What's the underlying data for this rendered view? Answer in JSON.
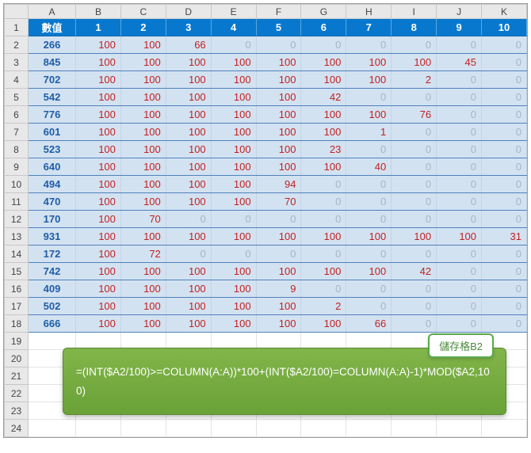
{
  "columns": [
    "A",
    "B",
    "C",
    "D",
    "E",
    "F",
    "G",
    "H",
    "I",
    "J",
    "K"
  ],
  "row_numbers": [
    1,
    2,
    3,
    4,
    5,
    6,
    7,
    8,
    9,
    10,
    11,
    12,
    13,
    14,
    15,
    16,
    17,
    18,
    19,
    20,
    21,
    22,
    23,
    24
  ],
  "header": {
    "label": "數值",
    "nums": [
      1,
      2,
      3,
      4,
      5,
      6,
      7,
      8,
      9,
      10
    ]
  },
  "rows": [
    {
      "val": 266,
      "cells": [
        100,
        100,
        66,
        0,
        0,
        0,
        0,
        0,
        0,
        0
      ]
    },
    {
      "val": 845,
      "cells": [
        100,
        100,
        100,
        100,
        100,
        100,
        100,
        100,
        45,
        0
      ]
    },
    {
      "val": 702,
      "cells": [
        100,
        100,
        100,
        100,
        100,
        100,
        100,
        2,
        0,
        0
      ]
    },
    {
      "val": 542,
      "cells": [
        100,
        100,
        100,
        100,
        100,
        42,
        0,
        0,
        0,
        0
      ]
    },
    {
      "val": 776,
      "cells": [
        100,
        100,
        100,
        100,
        100,
        100,
        100,
        76,
        0,
        0
      ]
    },
    {
      "val": 601,
      "cells": [
        100,
        100,
        100,
        100,
        100,
        100,
        1,
        0,
        0,
        0
      ]
    },
    {
      "val": 523,
      "cells": [
        100,
        100,
        100,
        100,
        100,
        23,
        0,
        0,
        0,
        0
      ]
    },
    {
      "val": 640,
      "cells": [
        100,
        100,
        100,
        100,
        100,
        100,
        40,
        0,
        0,
        0
      ]
    },
    {
      "val": 494,
      "cells": [
        100,
        100,
        100,
        100,
        94,
        0,
        0,
        0,
        0,
        0
      ]
    },
    {
      "val": 470,
      "cells": [
        100,
        100,
        100,
        100,
        70,
        0,
        0,
        0,
        0,
        0
      ]
    },
    {
      "val": 170,
      "cells": [
        100,
        70,
        0,
        0,
        0,
        0,
        0,
        0,
        0,
        0
      ]
    },
    {
      "val": 931,
      "cells": [
        100,
        100,
        100,
        100,
        100,
        100,
        100,
        100,
        100,
        31
      ]
    },
    {
      "val": 172,
      "cells": [
        100,
        72,
        0,
        0,
        0,
        0,
        0,
        0,
        0,
        0
      ]
    },
    {
      "val": 742,
      "cells": [
        100,
        100,
        100,
        100,
        100,
        100,
        100,
        42,
        0,
        0
      ]
    },
    {
      "val": 409,
      "cells": [
        100,
        100,
        100,
        100,
        9,
        0,
        0,
        0,
        0,
        0
      ]
    },
    {
      "val": 502,
      "cells": [
        100,
        100,
        100,
        100,
        100,
        2,
        0,
        0,
        0,
        0
      ]
    },
    {
      "val": 666,
      "cells": [
        100,
        100,
        100,
        100,
        100,
        100,
        66,
        0,
        0,
        0
      ]
    }
  ],
  "callout": {
    "tag": "儲存格B2",
    "formula": "=(INT($A2/100)>=COLUMN(A:A))*100+(INT($A2/100)=COLUMN(A:A)-1)*MOD($A2,100)"
  },
  "chart_data": {
    "type": "table",
    "title": "數值",
    "categories": [
      1,
      2,
      3,
      4,
      5,
      6,
      7,
      8,
      9,
      10
    ],
    "series": [
      {
        "name": 266,
        "values": [
          100,
          100,
          66,
          0,
          0,
          0,
          0,
          0,
          0,
          0
        ]
      },
      {
        "name": 845,
        "values": [
          100,
          100,
          100,
          100,
          100,
          100,
          100,
          100,
          45,
          0
        ]
      },
      {
        "name": 702,
        "values": [
          100,
          100,
          100,
          100,
          100,
          100,
          100,
          2,
          0,
          0
        ]
      },
      {
        "name": 542,
        "values": [
          100,
          100,
          100,
          100,
          100,
          42,
          0,
          0,
          0,
          0
        ]
      },
      {
        "name": 776,
        "values": [
          100,
          100,
          100,
          100,
          100,
          100,
          100,
          76,
          0,
          0
        ]
      },
      {
        "name": 601,
        "values": [
          100,
          100,
          100,
          100,
          100,
          100,
          1,
          0,
          0,
          0
        ]
      },
      {
        "name": 523,
        "values": [
          100,
          100,
          100,
          100,
          100,
          23,
          0,
          0,
          0,
          0
        ]
      },
      {
        "name": 640,
        "values": [
          100,
          100,
          100,
          100,
          100,
          100,
          40,
          0,
          0,
          0
        ]
      },
      {
        "name": 494,
        "values": [
          100,
          100,
          100,
          100,
          94,
          0,
          0,
          0,
          0,
          0
        ]
      },
      {
        "name": 470,
        "values": [
          100,
          100,
          100,
          100,
          70,
          0,
          0,
          0,
          0,
          0
        ]
      },
      {
        "name": 170,
        "values": [
          100,
          70,
          0,
          0,
          0,
          0,
          0,
          0,
          0,
          0
        ]
      },
      {
        "name": 931,
        "values": [
          100,
          100,
          100,
          100,
          100,
          100,
          100,
          100,
          100,
          31
        ]
      },
      {
        "name": 172,
        "values": [
          100,
          72,
          0,
          0,
          0,
          0,
          0,
          0,
          0,
          0
        ]
      },
      {
        "name": 742,
        "values": [
          100,
          100,
          100,
          100,
          100,
          100,
          100,
          42,
          0,
          0
        ]
      },
      {
        "name": 409,
        "values": [
          100,
          100,
          100,
          100,
          9,
          0,
          0,
          0,
          0,
          0
        ]
      },
      {
        "name": 502,
        "values": [
          100,
          100,
          100,
          100,
          100,
          2,
          0,
          0,
          0,
          0
        ]
      },
      {
        "name": 666,
        "values": [
          100,
          100,
          100,
          100,
          100,
          100,
          66,
          0,
          0,
          0
        ]
      }
    ]
  }
}
